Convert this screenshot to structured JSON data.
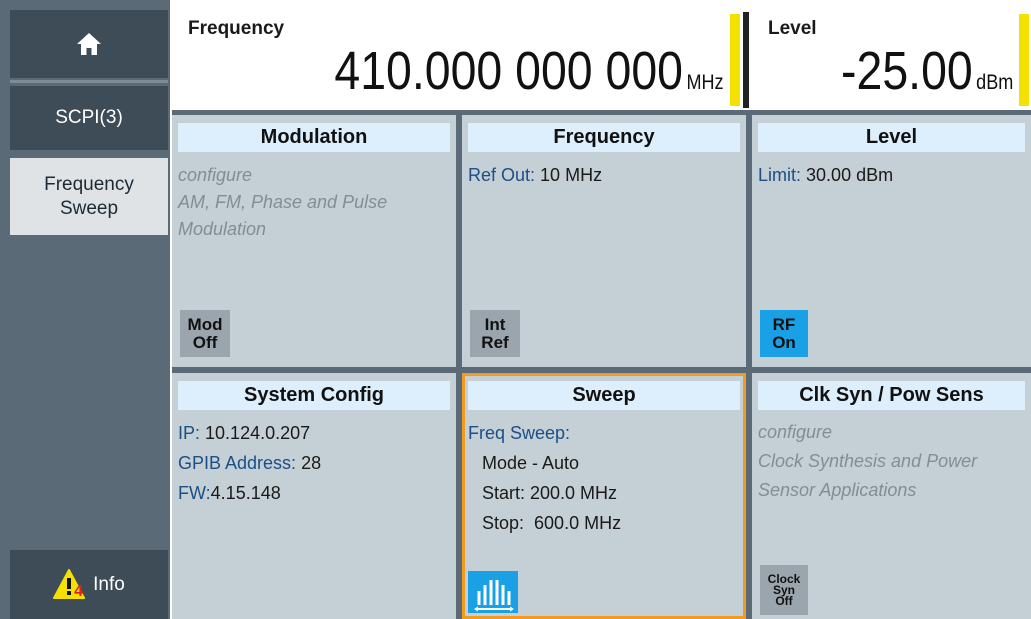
{
  "sidebar": {
    "home_icon": "home-icon",
    "scpi_label": "SCPI(3)",
    "freq_sweep_line1": "Frequency",
    "freq_sweep_line2": "Sweep",
    "info_label": "Info",
    "info_count": "4"
  },
  "frequency_display": {
    "label": "Frequency",
    "value": "410.000 000 000",
    "unit": "MHz"
  },
  "level_display": {
    "label": "Level",
    "value": "-25.00",
    "unit": "dBm"
  },
  "tiles": {
    "modulation": {
      "title": "Modulation",
      "line1": "configure",
      "line2": "AM, FM, Phase and Pulse",
      "line3": "Modulation",
      "softkey_line1": "Mod",
      "softkey_line2": "Off"
    },
    "frequency": {
      "title": "Frequency",
      "ref_out_key": "Ref Out:",
      "ref_out_value": "10 MHz",
      "softkey_line1": "Int",
      "softkey_line2": "Ref"
    },
    "level": {
      "title": "Level",
      "limit_key": "Limit:",
      "limit_value": "30.00 dBm",
      "softkey_line1": "RF",
      "softkey_line2": "On"
    },
    "system_config": {
      "title": "System Config",
      "ip_key": "IP:",
      "ip_value": "10.124.0.207",
      "gpib_key": "GPIB Address:",
      "gpib_value": "28",
      "fw_key": "FW:",
      "fw_value": "4.15.148"
    },
    "sweep": {
      "title": "Sweep",
      "freq_sweep_key": "Freq Sweep:",
      "mode": "Mode - Auto",
      "start": "Start: 200.0 MHz",
      "stop": "Stop:  600.0 MHz",
      "icon": "sweep-icon"
    },
    "clk_syn": {
      "title": "Clk Syn / Pow Sens",
      "line1": "configure",
      "line2": "Clock Synthesis and Power",
      "line3": "Sensor Applications",
      "softkey_line1": "Clock",
      "softkey_line2": "Syn",
      "softkey_line3": "Off"
    }
  },
  "colors": {
    "sidebar": "#5b6a77",
    "sidebar_button": "#3e4c57",
    "tile": "#c5cfd6",
    "tile_title": "#ddeefc",
    "key_text": "#1b4f86",
    "accent_blue": "#1aa0e4",
    "selection_orange": "#f29b20",
    "level_marker": "#f4e100"
  }
}
